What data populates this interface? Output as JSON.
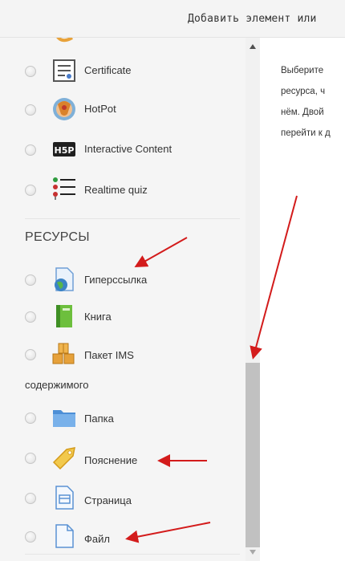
{
  "dialog": {
    "title": "Добавить элемент или"
  },
  "activities": [
    {
      "label": "Certificate",
      "icon": "certificate-icon"
    },
    {
      "label": "HotPot",
      "icon": "hotpot-icon"
    },
    {
      "label": "Interactive Content",
      "icon": "h5p-icon"
    },
    {
      "label": "Realtime quiz",
      "icon": "list-icon"
    }
  ],
  "resources": {
    "heading": "РЕСУРСЫ",
    "items": [
      {
        "label": "Гиперссылка",
        "icon": "globe-link-icon"
      },
      {
        "label": "Книга",
        "icon": "book-icon"
      },
      {
        "label": "Пакет IMS",
        "label_cont": "содержимого",
        "icon": "ims-package-icon"
      },
      {
        "label": "Папка",
        "icon": "folder-icon"
      },
      {
        "label": "Пояснение",
        "icon": "label-tag-icon"
      },
      {
        "label": "Страница",
        "icon": "page-icon"
      },
      {
        "label": "Файл",
        "icon": "file-icon"
      }
    ]
  },
  "help": {
    "lines": [
      "Выберите",
      "ресурса, ч",
      "нём. Двой",
      "перейти к д"
    ]
  },
  "colors": {
    "annotation_arrow": "#d31b1b",
    "scroll_thumb": "#c1c1c1",
    "panel": "#f5f5f5"
  }
}
